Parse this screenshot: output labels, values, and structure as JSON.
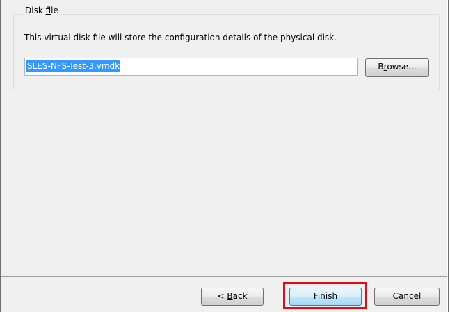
{
  "disk_file": {
    "title_prefix": "Disk ",
    "title_access_key": "f",
    "title_suffix": "ile",
    "description": "This virtual disk file will store the configuration details of the physical disk.",
    "file_name": "SLES-NFS-Test-3.vmdk",
    "browse": {
      "prefix": "B",
      "access_key": "r",
      "suffix": "owse..."
    }
  },
  "buttons": {
    "back": {
      "prefix": "< ",
      "access_key": "B",
      "suffix": "ack"
    },
    "finish_label": "Finish",
    "cancel_label": "Cancel"
  },
  "colors": {
    "highlight": "#e30a13",
    "selection": "#3399ff",
    "dialog_background": "#f0f0f0"
  }
}
